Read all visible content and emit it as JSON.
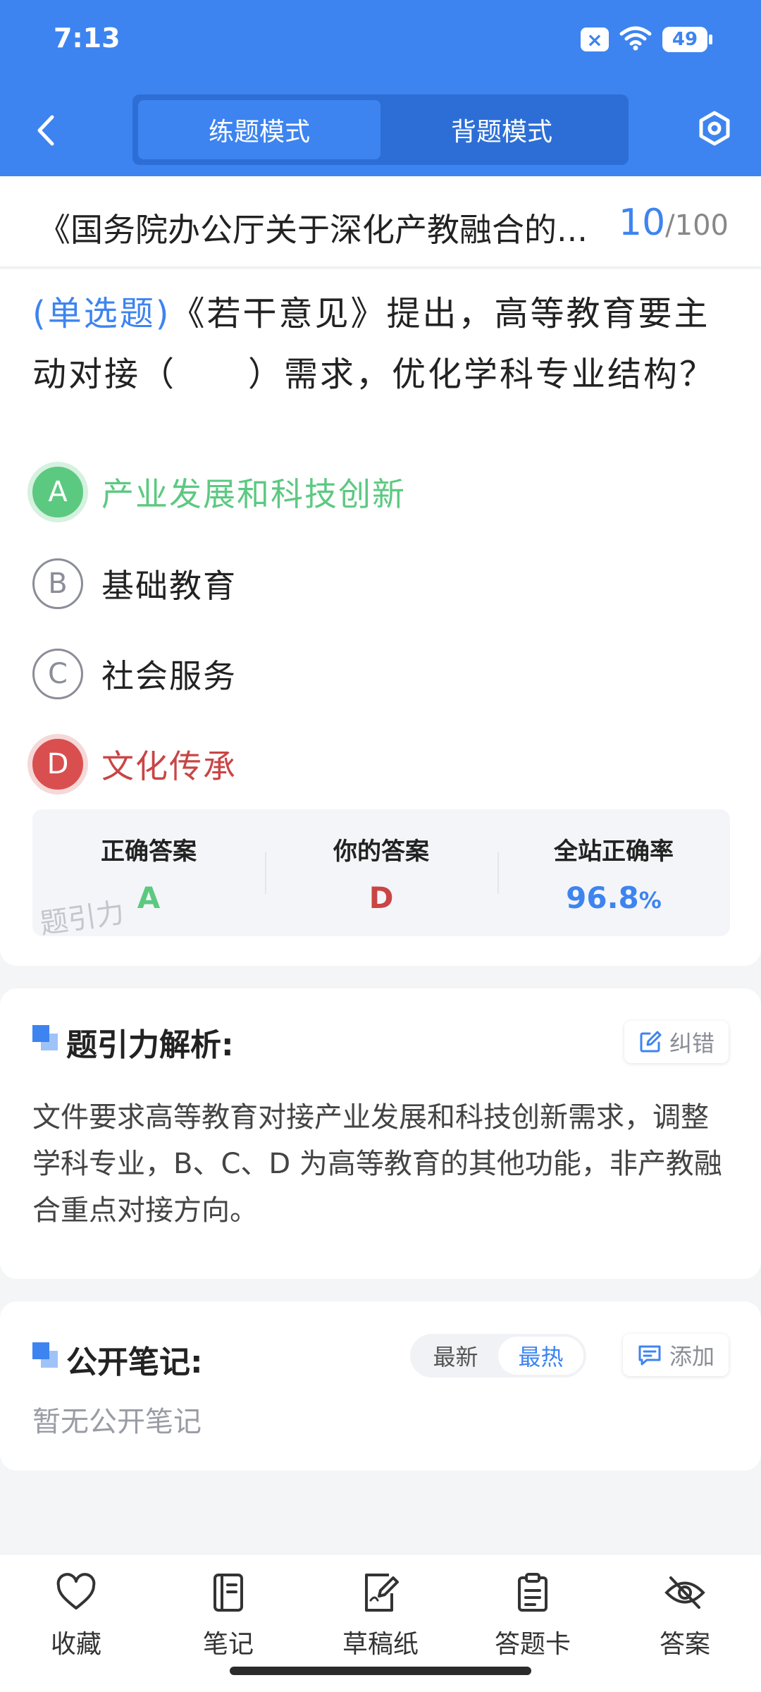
{
  "status_bar": {
    "time": "7:13",
    "x_badge": "×",
    "battery": "49"
  },
  "header": {
    "tabs": [
      {
        "label": "练题模式",
        "active": true
      },
      {
        "label": "背题模式",
        "active": false
      }
    ]
  },
  "title_row": {
    "title": "《国务院办公厅关于深化产教融合的...",
    "current": "10",
    "total": "/100"
  },
  "question": {
    "type": "(单选题)",
    "text": "《若干意见》提出，高等教育要主动对接（　　）需求，优化学科专业结构？",
    "options": [
      {
        "letter": "A",
        "text": "产业发展和科技创新",
        "state": "correct"
      },
      {
        "letter": "B",
        "text": "基础教育",
        "state": "normal"
      },
      {
        "letter": "C",
        "text": "社会服务",
        "state": "normal"
      },
      {
        "letter": "D",
        "text": "文化传承",
        "state": "wrong"
      }
    ]
  },
  "answer_summary": {
    "correct_label": "正确答案",
    "correct_value": "A",
    "your_label": "你的答案",
    "your_value": "D",
    "rate_label": "全站正确率",
    "rate_value": "96.8",
    "rate_unit": "%",
    "watermark": "题引力"
  },
  "explanation": {
    "title": "题引力解析:",
    "report_label": "纠错",
    "text": "文件要求高等教育对接产业发展和科技创新需求，调整学科专业，B、C、D 为高等教育的其他功能，非产教融合重点对接方向。"
  },
  "notes": {
    "title": "公开笔记:",
    "sort_tabs": [
      {
        "label": "最新",
        "active": false
      },
      {
        "label": "最热",
        "active": true
      }
    ],
    "add_label": "添加",
    "empty_text": "暂无公开笔记"
  },
  "bottom_nav": [
    {
      "label": "收藏",
      "icon": "heart-icon"
    },
    {
      "label": "笔记",
      "icon": "notebook-icon"
    },
    {
      "label": "草稿纸",
      "icon": "draft-paper-icon"
    },
    {
      "label": "答题卡",
      "icon": "answer-card-icon"
    },
    {
      "label": "答案",
      "icon": "eye-off-icon"
    }
  ],
  "colors": {
    "primary": "#3d84f0",
    "correct": "#5cc981",
    "wrong": "#c94545"
  }
}
